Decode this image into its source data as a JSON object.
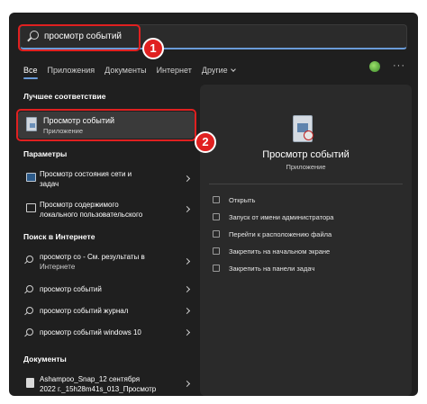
{
  "search": {
    "query": "просмотр событий"
  },
  "callouts": {
    "one": "1",
    "two": "2"
  },
  "tabs": [
    {
      "label": "Все",
      "active": true
    },
    {
      "label": "Приложения"
    },
    {
      "label": "Документы"
    },
    {
      "label": "Интернет"
    },
    {
      "label": "Другие"
    }
  ],
  "more_label": "···",
  "best_match": {
    "section": "Лучшее соответствие",
    "title": "Просмотр событий",
    "subtitle": "Приложение"
  },
  "settings": {
    "section": "Параметры",
    "items": [
      {
        "line1": "Просмотр состояния сети и",
        "line2": "задач"
      },
      {
        "line1": "Просмотр содержимого",
        "line2": "локального пользовательского"
      }
    ]
  },
  "web": {
    "section": "Поиск в Интернете",
    "items": [
      {
        "line1": "просмотр со - См. результаты в",
        "line2": "Интернете"
      },
      {
        "line1": "просмотр событий"
      },
      {
        "line1": "просмотр событий журнал"
      },
      {
        "line1": "просмотр событий windows 10"
      }
    ]
  },
  "documents": {
    "section": "Документы",
    "items": [
      {
        "line1": "Ashampoo_Snap_12 сентября",
        "line2": "2022 г._15h28m41s_013_Просмотр"
      }
    ]
  },
  "detail": {
    "title": "Просмотр событий",
    "subtitle": "Приложение",
    "actions": [
      {
        "label": "Открыть",
        "icon": "open-icon"
      },
      {
        "label": "Запуск от имени администратора",
        "icon": "shield-icon"
      },
      {
        "label": "Перейти к расположению файла",
        "icon": "folder-icon"
      },
      {
        "label": "Закрепить на начальном экране",
        "icon": "pin-icon"
      },
      {
        "label": "Закрепить на панели задач",
        "icon": "pin-icon"
      }
    ]
  },
  "colors": {
    "accent": "#6a9bd8",
    "callout": "#e02020",
    "panel": "#2a2a2a",
    "background": "#1f1f1f"
  }
}
